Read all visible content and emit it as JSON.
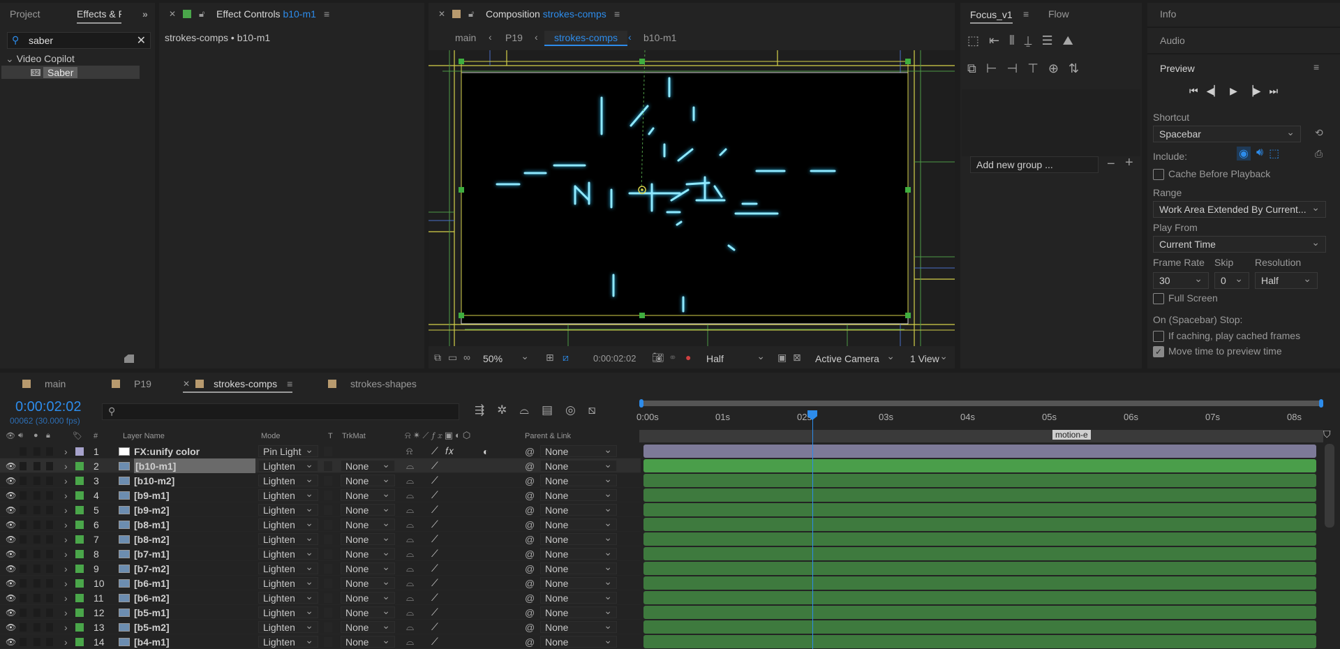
{
  "project_panel": {
    "tab_project": "Project",
    "tab_effects": "Effects & P",
    "search_value": "saber",
    "tree_folder": "Video Copilot",
    "tree_item": "Saber",
    "tree_item_badge": "32"
  },
  "effect_controls": {
    "title": "Effect Controls",
    "layer": "b10-m1",
    "breadcrumb": "strokes-comps • b10-m1"
  },
  "composition": {
    "title": "Composition",
    "name": "strokes-comps",
    "crumbs": [
      "main",
      "P19",
      "strokes-comps",
      "b10-m1"
    ],
    "zoom": "50%",
    "timecode": "0:00:02:02",
    "resolution": "Half",
    "camera": "Active Camera",
    "views": "1 View"
  },
  "focus_panel": {
    "tab_focus": "Focus_v1",
    "tab_flow": "Flow",
    "add_group_placeholder": "Add new group ..."
  },
  "right_panel": {
    "info": "Info",
    "audio": "Audio",
    "preview": "Preview",
    "shortcut_label": "Shortcut",
    "shortcut_value": "Spacebar",
    "include_label": "Include:",
    "cache_before": "Cache Before Playback",
    "range_label": "Range",
    "range_value": "Work Area Extended By Current...",
    "play_from_label": "Play From",
    "play_from_value": "Current Time",
    "frame_rate_label": "Frame Rate",
    "frame_rate_value": "30",
    "skip_label": "Skip",
    "skip_value": "0",
    "resolution_label": "Resolution",
    "resolution_value": "Half",
    "full_screen": "Full Screen",
    "on_stop_label": "On (Spacebar) Stop:",
    "if_caching": "If caching, play cached frames",
    "move_time": "Move time to preview time"
  },
  "timeline_tabs": [
    {
      "label": "main",
      "color": "#b89a6e"
    },
    {
      "label": "P19",
      "color": "#b89a6e"
    },
    {
      "label": "strokes-comps",
      "color": "#b89a6e"
    },
    {
      "label": "strokes-shapes",
      "color": "#b89a6e"
    }
  ],
  "timeline": {
    "timecode": "0:00:02:02",
    "frames": "00062 (30.000 fps)",
    "col_hash": "#",
    "col_layer_name": "Layer Name",
    "col_mode": "Mode",
    "col_t": "T",
    "col_trkmat": "TrkMat",
    "col_parent": "Parent & Link",
    "ruler": [
      "0:00s",
      "01s",
      "02s",
      "03s",
      "04s",
      "05s",
      "06s",
      "07s",
      "08s"
    ],
    "marker": "motion-e",
    "layers": [
      {
        "num": "1",
        "name": "FX:unify color",
        "mode": "Pin Light",
        "trkmat": "",
        "parent": "None",
        "color": "#a7a3cc"
      },
      {
        "num": "2",
        "name": "[b10-m1]",
        "mode": "Lighten",
        "trkmat": "None",
        "parent": "None",
        "color": "#4aa64a"
      },
      {
        "num": "3",
        "name": "[b10-m2]",
        "mode": "Lighten",
        "trkmat": "None",
        "parent": "None",
        "color": "#4aa64a"
      },
      {
        "num": "4",
        "name": "[b9-m1]",
        "mode": "Lighten",
        "trkmat": "None",
        "parent": "None",
        "color": "#4aa64a"
      },
      {
        "num": "5",
        "name": "[b9-m2]",
        "mode": "Lighten",
        "trkmat": "None",
        "parent": "None",
        "color": "#4aa64a"
      },
      {
        "num": "6",
        "name": "[b8-m1]",
        "mode": "Lighten",
        "trkmat": "None",
        "parent": "None",
        "color": "#4aa64a"
      },
      {
        "num": "7",
        "name": "[b8-m2]",
        "mode": "Lighten",
        "trkmat": "None",
        "parent": "None",
        "color": "#4aa64a"
      },
      {
        "num": "8",
        "name": "[b7-m1]",
        "mode": "Lighten",
        "trkmat": "None",
        "parent": "None",
        "color": "#4aa64a"
      },
      {
        "num": "9",
        "name": "[b7-m2]",
        "mode": "Lighten",
        "trkmat": "None",
        "parent": "None",
        "color": "#4aa64a"
      },
      {
        "num": "10",
        "name": "[b6-m1]",
        "mode": "Lighten",
        "trkmat": "None",
        "parent": "None",
        "color": "#4aa64a"
      },
      {
        "num": "11",
        "name": "[b6-m2]",
        "mode": "Lighten",
        "trkmat": "None",
        "parent": "None",
        "color": "#4aa64a"
      },
      {
        "num": "12",
        "name": "[b5-m1]",
        "mode": "Lighten",
        "trkmat": "None",
        "parent": "None",
        "color": "#4aa64a"
      },
      {
        "num": "13",
        "name": "[b5-m2]",
        "mode": "Lighten",
        "trkmat": "None",
        "parent": "None",
        "color": "#4aa64a"
      },
      {
        "num": "14",
        "name": "[b4-m1]",
        "mode": "Lighten",
        "trkmat": "None",
        "parent": "None",
        "color": "#4aa64a"
      }
    ]
  }
}
